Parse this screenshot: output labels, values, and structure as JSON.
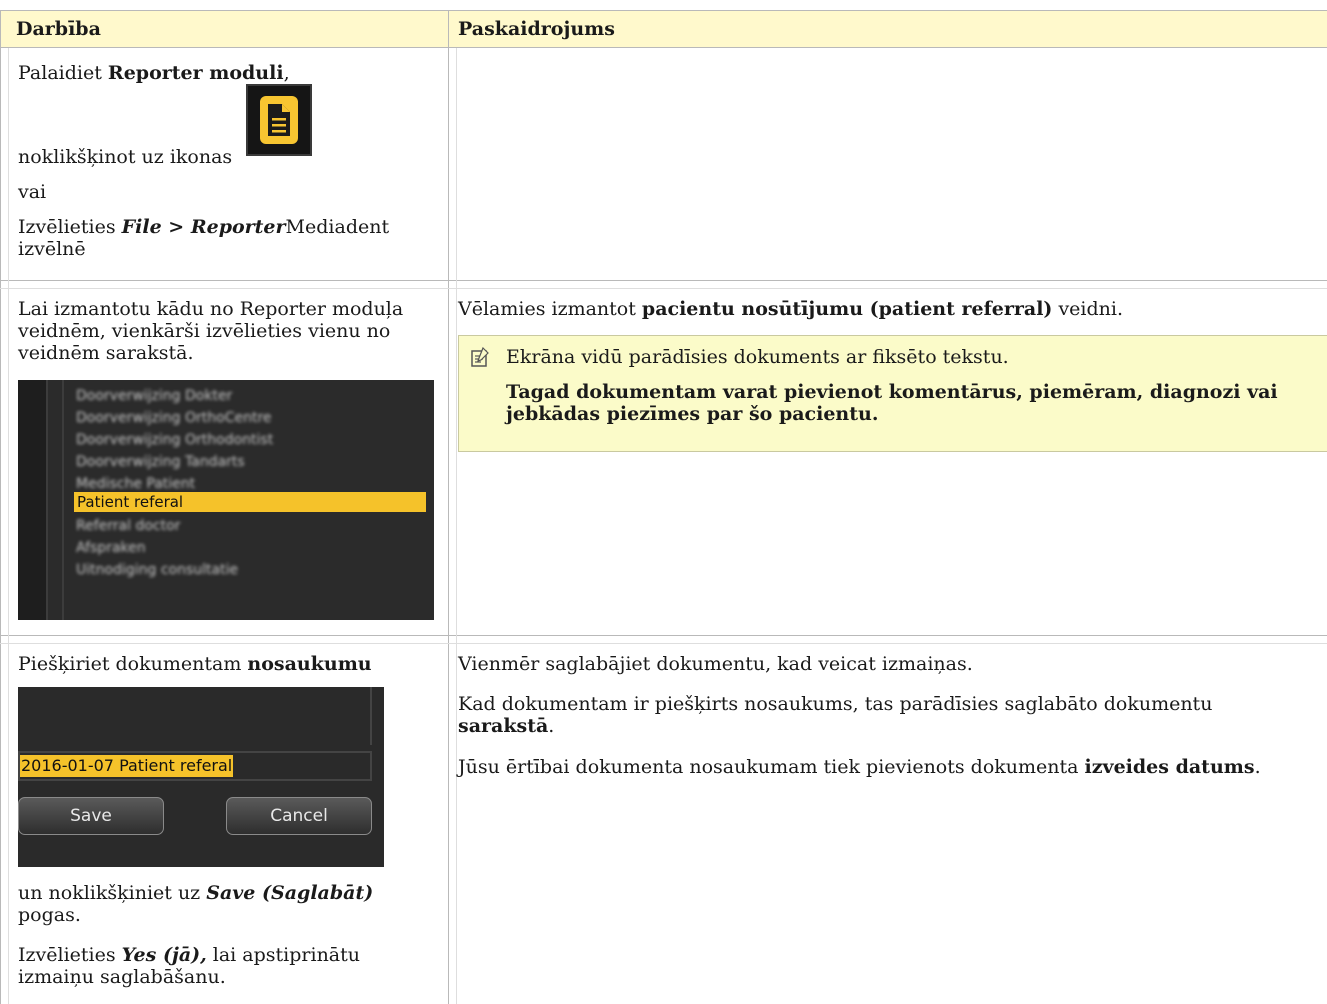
{
  "table": {
    "headers": [
      "Darbība",
      "Paskaidrojums"
    ]
  },
  "row1": {
    "line1_pre": "Palaidiet ",
    "line1_bold": "Reporter moduli",
    "line1_post": ",",
    "line2": "noklikšķinot uz ikonas",
    "line3": "vai",
    "line4_pre": "Izvēlieties ",
    "line4_bold1": "File > ",
    "line4_bold2": "Reporter",
    "line4_post": "Mediadent",
    "line5": "izvēlnē"
  },
  "row2": {
    "left_text": "Lai izmantotu kādu no Reporter moduļa veidnēm, vienkārši izvēlieties vienu no veidnēm sarakstā.",
    "right_pre": "Vēlamies izmantot ",
    "right_bold": "pacientu nosūtījumu (patient referral)",
    "right_post": " veidni.",
    "note_line1": "Ekrāna vidū parādīsies dokuments ar fiksēto tekstu.",
    "note_bold": "Tagad dokumentam varat pievienot komentārus, piemēram, diagnozi vai jebkādas piezīmes par šo pacientu.",
    "list_items": [
      "Doorverwijzing Dokter",
      "Doorverwijzing OrthoCentre",
      "Doorverwijzing Orthodontist",
      "Doorverwijzing Tandarts",
      "Medische Patient",
      "Patient referal",
      "Referral doctor",
      "Afspraken",
      "Uitnodiging consultatie"
    ],
    "list_selected": "Patient referal"
  },
  "row3": {
    "left_pre": "Piešķiriet dokumentam ",
    "left_bold": "nosaukumu",
    "field_value": "2016-01-07 Patient referal",
    "save_label": "Save",
    "cancel_label": "Cancel",
    "after1_pre": "un noklikšķiniet uz ",
    "after1_bold": "Save (Saglabāt)",
    "after1_line2": "pogas.",
    "after2_pre": "Izvēlieties ",
    "after2_bold": "Yes (jā),",
    "after2_post": " lai apstiprinātu",
    "after2_line2": "izmaiņu saglabāšanu.",
    "right_p1": "Vienmēr saglabājiet dokumentu, kad veicat izmaiņas.",
    "right_p2_line1": "Kad dokumentam ir piešķirts nosaukums, tas parādīsies saglabāto dokumentu",
    "right_p2_bold": "sarakstā",
    "right_p2_end": ".",
    "right_p3_pre": "Jūsu ērtībai dokumenta nosaukumam tiek pievienots dokumenta ",
    "right_p3_bold": "izveides datums",
    "right_p3_end": "."
  },
  "colors": {
    "header_bg": "#fff9cc",
    "note_bg": "#fbfbc9",
    "icon_accent": "#f7c531",
    "selected_item": "#f5c22a"
  },
  "icons": {
    "reporter": "document-icon",
    "note": "note-icon"
  }
}
